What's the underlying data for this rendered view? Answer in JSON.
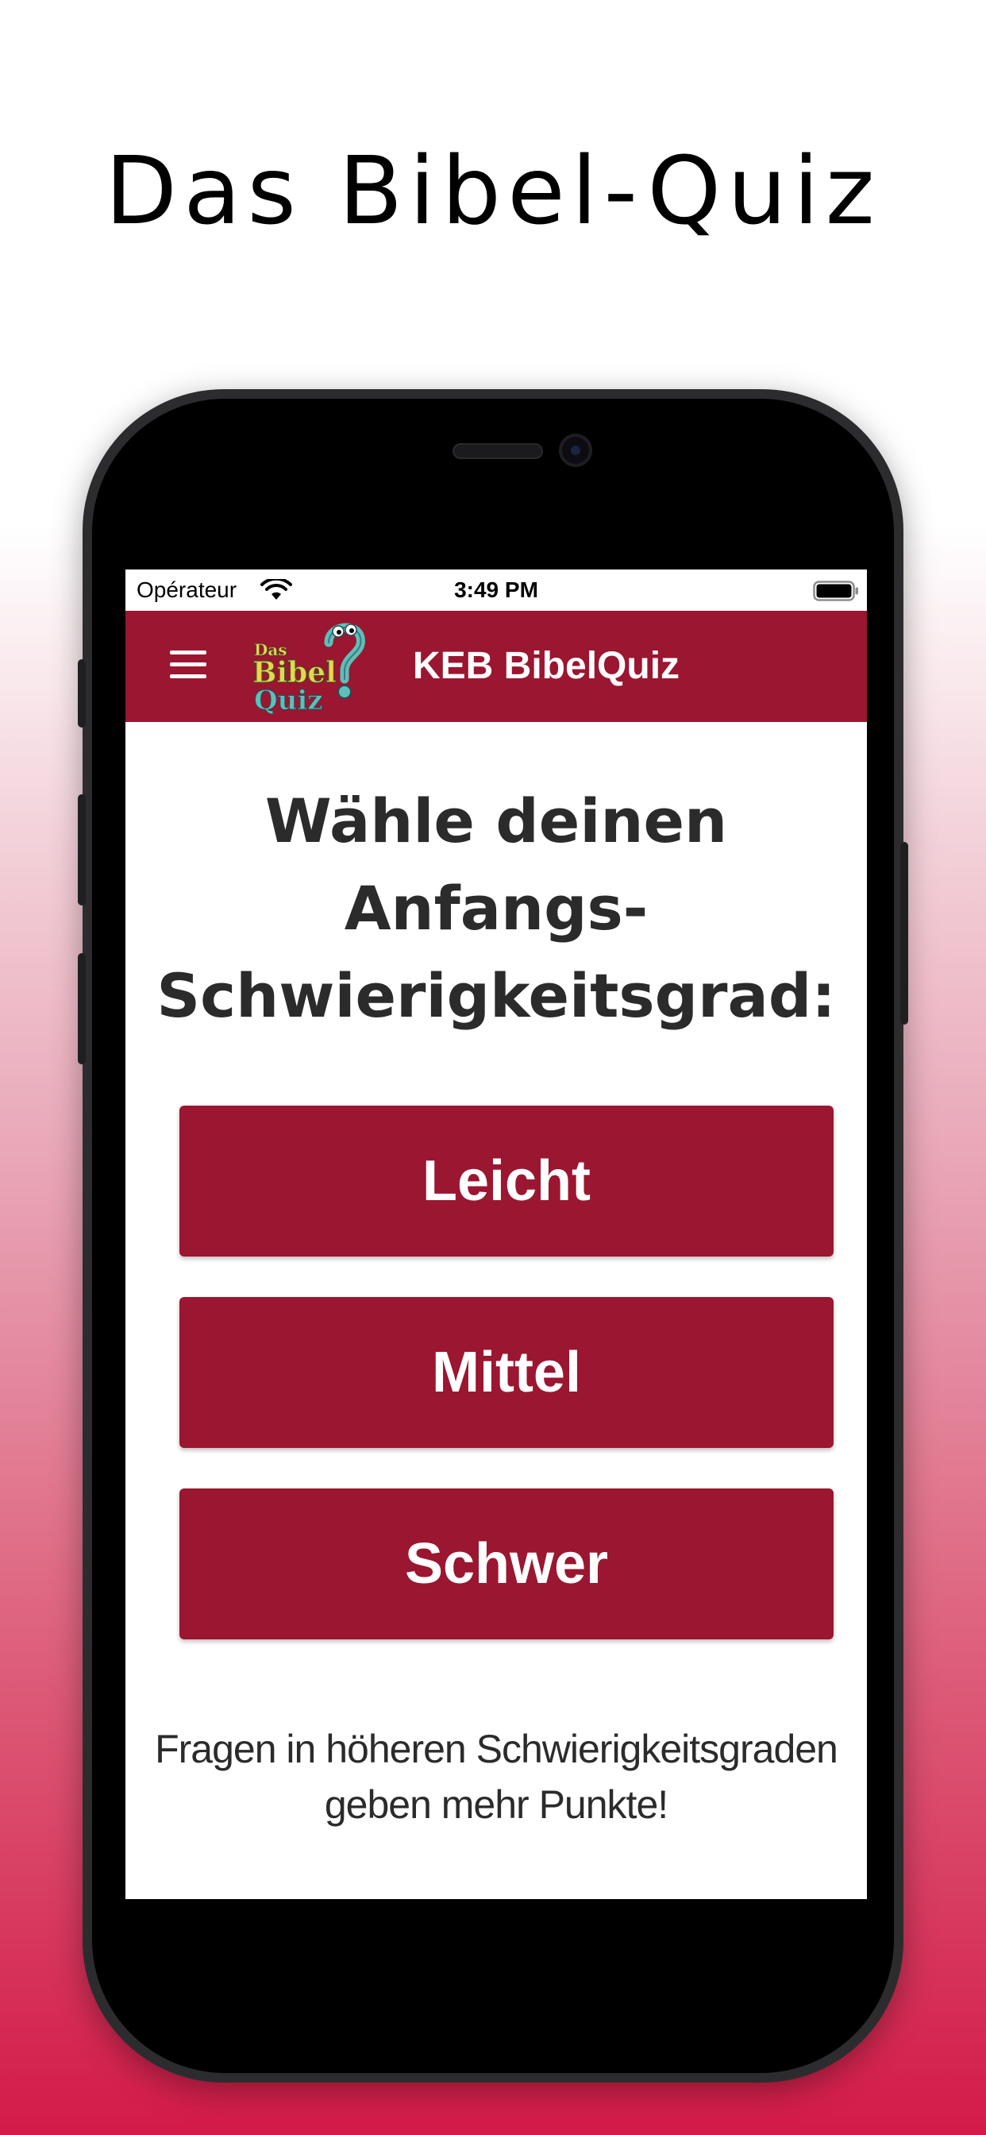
{
  "promo": {
    "headline": "Das Bibel-Quiz"
  },
  "status_bar": {
    "carrier": "Opérateur",
    "time": "3:49 PM",
    "wifi_icon": "wifi-icon",
    "battery_icon": "battery-full-icon"
  },
  "app_bar": {
    "menu_icon": "hamburger-menu-icon",
    "logo_text": [
      "Das",
      "Bibel",
      "Quiz"
    ],
    "title": "KEB BibelQuiz"
  },
  "main": {
    "heading_lines": [
      "Wähle deinen",
      "Anfangs-",
      "Schwierigkeitsgrad:"
    ],
    "levels": [
      {
        "label": "Leicht"
      },
      {
        "label": "Mittel"
      },
      {
        "label": "Schwer"
      }
    ],
    "note": "Fragen in höheren Schwierigkeitsgraden geben mehr Punkte!"
  },
  "colors": {
    "brand": "#9b1630",
    "gradient_bottom": "#d31a48",
    "text_dark": "#2b2b2b"
  }
}
